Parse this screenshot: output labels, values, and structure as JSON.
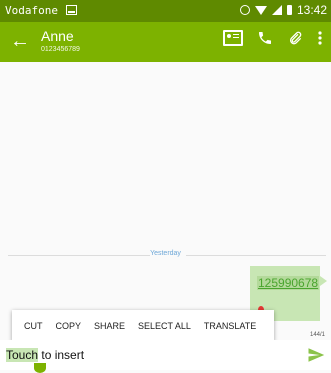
{
  "status_bar": {
    "carrier": "Vodafone",
    "time": "13:42"
  },
  "app_bar": {
    "contact_name": "Anne",
    "contact_number": "0123456789"
  },
  "conversation": {
    "date_divider": "Yesterday",
    "message_text": "125990678"
  },
  "context_menu": {
    "cut": "CUT",
    "copy": "COPY",
    "share": "SHARE",
    "select_all": "SELECT ALL",
    "translate": "TRANSLATE"
  },
  "composer": {
    "char_counter": "144/1",
    "selected_word": "Touch",
    "rest_text": " to insert"
  },
  "colors": {
    "status_bar": "#5f8a00",
    "app_bar": "#7db200",
    "bubble": "#c8e6b4",
    "link": "#4aa52e"
  }
}
